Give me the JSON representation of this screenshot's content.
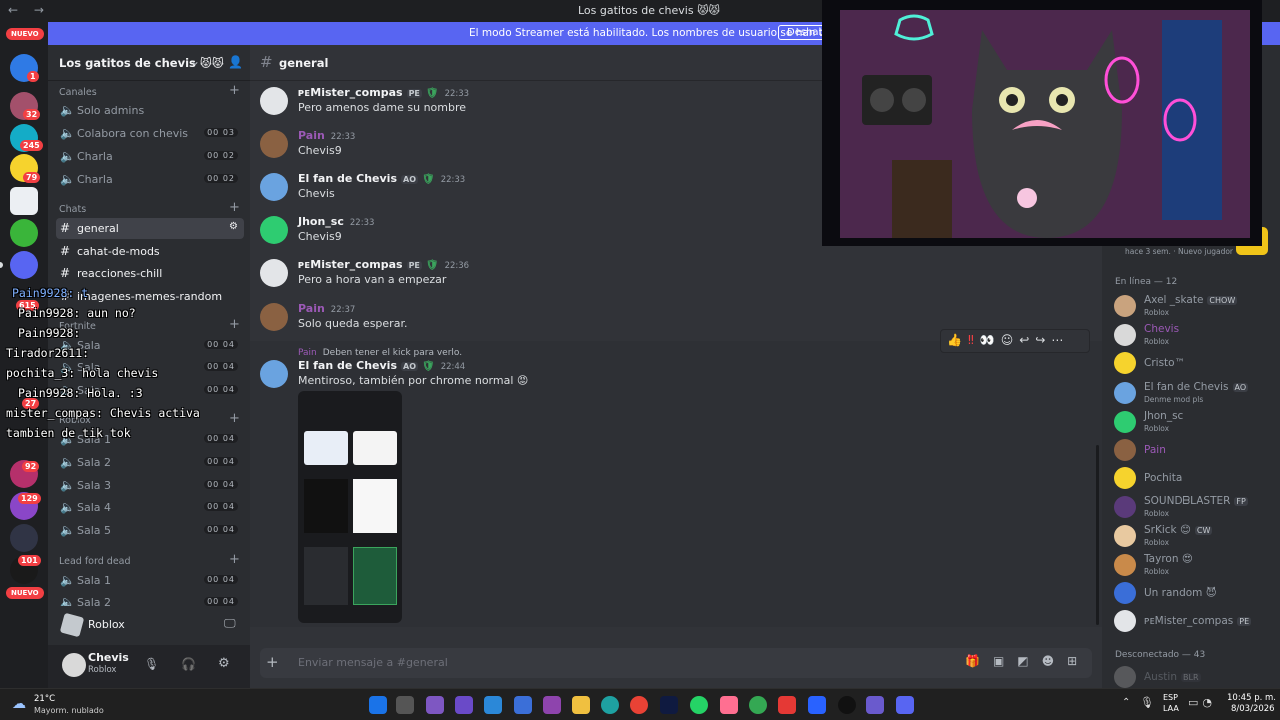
{
  "window": {
    "title": "Los gatitos de chevis 😾😾"
  },
  "banner": {
    "text": "El modo Streamer está habilitado. Los nombres de usuario se han truncado.",
    "button": "Deshabi"
  },
  "rail": {
    "badges": [
      "1",
      "32",
      "245",
      "79",
      "615",
      "27",
      "92",
      "129",
      "101"
    ],
    "new_label": "NUEVO"
  },
  "server": {
    "name": "Los gatitos de chevis 😾😾"
  },
  "sidebar": {
    "categories": {
      "canales": "Canales",
      "chats": "Chats",
      "fortnite": "Fortnite",
      "roblox": "Roblox",
      "leadford": "Lead ford dead"
    },
    "channels": [
      {
        "name": "Solo admins",
        "count": ""
      },
      {
        "name": "Colabora con chevis",
        "count": "00 03"
      },
      {
        "name": "Charla",
        "count": "00 02"
      },
      {
        "name": "Charla",
        "count": "00 02"
      },
      {
        "name": "general",
        "count": ""
      },
      {
        "name": "cahat-de-mods",
        "count": ""
      },
      {
        "name": "reacciones-chill",
        "count": ""
      },
      {
        "name": "imagenes-memes-random",
        "count": ""
      },
      {
        "name": "Sala",
        "count": "00 04"
      },
      {
        "name": "Sala",
        "count": "00 04"
      },
      {
        "name": "Sala",
        "count": "00 04"
      },
      {
        "name": "Sala 1",
        "count": "00 04"
      },
      {
        "name": "Sala 2",
        "count": "00 04"
      },
      {
        "name": "Sala 3",
        "count": "00 04"
      },
      {
        "name": "Sala 4",
        "count": "00 04"
      },
      {
        "name": "Sala 5",
        "count": "00 04"
      },
      {
        "name": "Sala 1",
        "count": "00 04"
      },
      {
        "name": "Sala 2",
        "count": "00 04"
      }
    ],
    "game": "Roblox",
    "user": {
      "name": "Chevis",
      "status": "Roblox"
    }
  },
  "chat": {
    "channel": "general",
    "messages": [
      {
        "author": "ᴘᴇMister_compas",
        "tag": "PE",
        "time": "22:33",
        "text": "Pero amenos dame su nombre"
      },
      {
        "author": "Pain",
        "tag": "",
        "time": "22:33",
        "text": "Chevis9"
      },
      {
        "author": "El fan de Chevis",
        "tag": "AO",
        "time": "22:33",
        "text": "Chevis"
      },
      {
        "author": "Jhon_sc",
        "tag": "",
        "time": "22:33",
        "text": "Chevis9"
      },
      {
        "author": "ᴘᴇMister_compas",
        "tag": "PE",
        "time": "22:36",
        "text": "Pero a hora van a empezar"
      },
      {
        "author": "Pain",
        "tag": "",
        "time": "22:37",
        "text": "Solo queda esperar."
      },
      {
        "author": "El fan de Chevis",
        "tag": "AO",
        "time": "22:44",
        "text": "Mentiroso, también por chrome normal 😡"
      }
    ],
    "reply_text": "Deben tener el kick para verlo.",
    "composer_placeholder": "Enviar mensaje a #general"
  },
  "overlay": [
    "Pain9928: t",
    "Pain9928: aun no?",
    "Pain9928:",
    "Tirador2611:",
    "pochita_3: hola chevis",
    "Pain9928: Hola. :3",
    "mister_compas: Chevis activa",
    "tambien de tik tok"
  ],
  "members": {
    "activity": "hace 3 sem. · Nuevo jugador",
    "online_header": "En línea — 12",
    "online": [
      {
        "name": "Axel _skate",
        "tag": "CHOW",
        "status": "Roblox"
      },
      {
        "name": "Chevis",
        "tag": "",
        "status": "Roblox"
      },
      {
        "name": "Cristo™",
        "tag": "",
        "status": ""
      },
      {
        "name": "El fan de Chevis",
        "tag": "AO",
        "status": "Denme mod pls"
      },
      {
        "name": "Jhon_sc",
        "tag": "",
        "status": "Roblox"
      },
      {
        "name": "Pain",
        "tag": "",
        "status": ""
      },
      {
        "name": "Pochita",
        "tag": "",
        "status": ""
      },
      {
        "name": "SOUNDᗷLASTER",
        "tag": "FP",
        "status": "Roblox"
      },
      {
        "name": "SrKick 😊",
        "tag": "CW",
        "status": "Roblox"
      },
      {
        "name": "Tayron 😍",
        "tag": "",
        "status": "Roblox"
      },
      {
        "name": "Un random 😈",
        "tag": "",
        "status": ""
      },
      {
        "name": "ᴘᴇMister_compas",
        "tag": "PE",
        "status": ""
      }
    ],
    "offline_header": "Desconectado — 43",
    "offline": [
      {
        "name": "Austin",
        "tag": "BLR"
      }
    ]
  },
  "taskbar": {
    "weather_temp": "21°C",
    "weather_desc": "Mayorm. nublado",
    "lang1": "ESP",
    "lang2": "LAA",
    "time": "10:45 p. m.",
    "date": "8/03/2026"
  }
}
